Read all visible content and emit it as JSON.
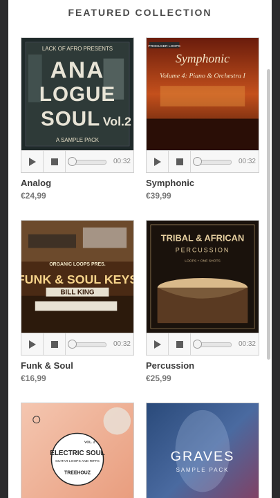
{
  "section": {
    "title": "FEATURED COLLECTION"
  },
  "products": [
    {
      "name": "Analog",
      "price": "€24,99",
      "duration": "00:32",
      "cover": {
        "top_text": "LACK OF AFRO PRESENTS",
        "line1": "ANA",
        "line2": "LOGUE",
        "line3": "SOUL",
        "vol": "Vol.2",
        "bottom_text": "A SAMPLE PACK"
      }
    },
    {
      "name": "Symphonic",
      "price": "€39,99",
      "duration": "00:32",
      "cover": {
        "badge": "PRODUCER LOOPS",
        "title": "Symphonic",
        "subtitle": "Volume 4: Piano & Orchestra I"
      }
    },
    {
      "name": "Funk & Soul",
      "price": "€16,99",
      "duration": "00:32",
      "cover": {
        "top_text": "ORGANIC LOOPS PRES.",
        "title": "FUNK & SOUL KEYS",
        "banner": "BILL KING"
      }
    },
    {
      "name": "Percussion",
      "price": "€25,99",
      "duration": "00:32",
      "cover": {
        "title": "TRIBAL & AFRICAN",
        "subtitle": "PERCUSSION",
        "small": "LOOPS + ONE SHOTS"
      }
    },
    {
      "name": "",
      "price": "",
      "duration": "",
      "cover": {
        "vol": "VOL. 2",
        "title": "ELECTRIC SOUL",
        "subtitle": "GUITAR LOOPS AND RIFFS",
        "brand": "TREEHOUZ"
      }
    },
    {
      "name": "",
      "price": "",
      "duration": "",
      "cover": {
        "title": "GRAVES",
        "subtitle": "SAMPLE PACK"
      }
    }
  ],
  "colors": {
    "frame": "#2b2b2d",
    "text_dark": "#3a3a3a",
    "text_price": "#777777"
  }
}
